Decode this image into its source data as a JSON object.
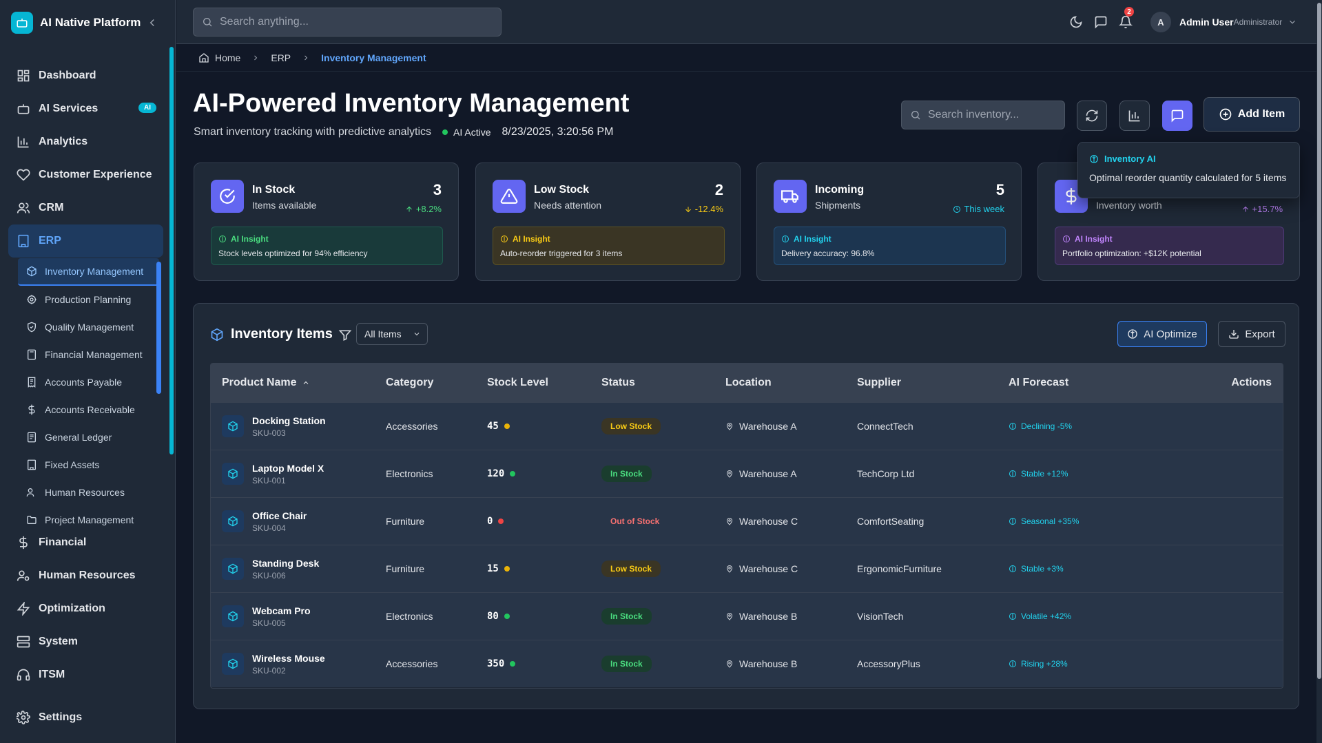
{
  "sidebar": {
    "brand": "AI Native Platform",
    "nav": [
      {
        "label": "Dashboard",
        "icon": "dashboard-icon"
      },
      {
        "label": "AI Services",
        "icon": "bot-icon",
        "badge": "AI"
      },
      {
        "label": "Analytics",
        "icon": "chart-icon"
      },
      {
        "label": "Customer Experience",
        "icon": "heart-icon"
      },
      {
        "label": "CRM",
        "icon": "users-icon"
      },
      {
        "label": "ERP",
        "icon": "building-icon"
      }
    ],
    "erp_sub": [
      {
        "label": "Inventory Management",
        "icon": "package-icon"
      },
      {
        "label": "Production Planning",
        "icon": "cog-icon"
      },
      {
        "label": "Quality Management",
        "icon": "shield-icon"
      },
      {
        "label": "Financial Management",
        "icon": "calculator-icon"
      },
      {
        "label": "Accounts Payable",
        "icon": "receipt-icon"
      },
      {
        "label": "Accounts Receivable",
        "icon": "dollar-icon"
      },
      {
        "label": "General Ledger",
        "icon": "book-icon"
      },
      {
        "label": "Fixed Assets",
        "icon": "building-icon"
      },
      {
        "label": "Human Resources",
        "icon": "users-icon"
      },
      {
        "label": "Project Management",
        "icon": "folder-icon"
      }
    ],
    "nav2": [
      {
        "label": "Financial",
        "icon": "dollar-icon"
      },
      {
        "label": "Human Resources",
        "icon": "user-cog-icon"
      },
      {
        "label": "Optimization",
        "icon": "zap-icon"
      },
      {
        "label": "System",
        "icon": "server-icon"
      },
      {
        "label": "ITSM",
        "icon": "headset-icon"
      }
    ],
    "settings": "Settings"
  },
  "topbar": {
    "search_placeholder": "Search anything...",
    "notif_count": "2",
    "user_initial": "A",
    "user_name": "Admin User",
    "user_role": "Administrator"
  },
  "breadcrumb": [
    "Home",
    "ERP",
    "Inventory Management"
  ],
  "header": {
    "title": "AI-Powered Inventory Management",
    "subtitle": "Smart inventory tracking with predictive analytics",
    "ai_status": "AI Active",
    "timestamp": "8/23/2025, 3:20:56 PM",
    "search_placeholder": "Search inventory...",
    "add_label": "Add Item"
  },
  "tooltip": {
    "title": "Inventory AI",
    "body": "Optimal reorder quantity calculated for 5 items"
  },
  "cards": [
    {
      "title": "In Stock",
      "sub": "Items available",
      "value": "3",
      "delta": "+8.2%",
      "insight_title": "AI Insight",
      "insight": "Stock levels optimized for 94% efficiency"
    },
    {
      "title": "Low Stock",
      "sub": "Needs attention",
      "value": "2",
      "delta": "-12.4%",
      "insight_title": "AI Insight",
      "insight": "Auto-reorder triggered for 3 items"
    },
    {
      "title": "Incoming",
      "sub": "Shipments",
      "value": "5",
      "delta": "This week",
      "insight_title": "AI Insight",
      "insight": "Delivery accuracy: 96.8%"
    },
    {
      "title": "",
      "sub": "Inventory worth",
      "value": "",
      "delta": "+15.7%",
      "insight_title": "AI Insight",
      "insight": "Portfolio optimization: +$12K potential"
    }
  ],
  "table": {
    "title": "Inventory Items",
    "filter": "All Items",
    "ai_optimize": "AI Optimize",
    "export": "Export",
    "columns": [
      "Product Name",
      "Category",
      "Stock Level",
      "Status",
      "Location",
      "Supplier",
      "AI Forecast",
      "Actions"
    ],
    "rows": [
      {
        "name": "Docking Station",
        "sku": "SKU-003",
        "category": "Accessories",
        "stock": "45",
        "level": "low",
        "status": "Low Stock",
        "location": "Warehouse A",
        "supplier": "ConnectTech",
        "forecast": "Declining -5%"
      },
      {
        "name": "Laptop Model X",
        "sku": "SKU-001",
        "category": "Electronics",
        "stock": "120",
        "level": "ok",
        "status": "In Stock",
        "location": "Warehouse A",
        "supplier": "TechCorp Ltd",
        "forecast": "Stable +12%"
      },
      {
        "name": "Office Chair",
        "sku": "SKU-004",
        "category": "Furniture",
        "stock": "0",
        "level": "out",
        "status": "Out of Stock",
        "location": "Warehouse C",
        "supplier": "ComfortSeating",
        "forecast": "Seasonal +35%"
      },
      {
        "name": "Standing Desk",
        "sku": "SKU-006",
        "category": "Furniture",
        "stock": "15",
        "level": "low",
        "status": "Low Stock",
        "location": "Warehouse C",
        "supplier": "ErgonomicFurniture",
        "forecast": "Stable +3%"
      },
      {
        "name": "Webcam Pro",
        "sku": "SKU-005",
        "category": "Electronics",
        "stock": "80",
        "level": "ok",
        "status": "In Stock",
        "location": "Warehouse B",
        "supplier": "VisionTech",
        "forecast": "Volatile +42%"
      },
      {
        "name": "Wireless Mouse",
        "sku": "SKU-002",
        "category": "Accessories",
        "stock": "350",
        "level": "ok",
        "status": "In Stock",
        "location": "Warehouse B",
        "supplier": "AccessoryPlus",
        "forecast": "Rising +28%"
      }
    ]
  },
  "colors": {
    "accent": "#06b6d4",
    "primary": "#3b82f6",
    "success": "#22c55e",
    "warning": "#eab308",
    "danger": "#ef4444",
    "purple": "#a855f7"
  }
}
